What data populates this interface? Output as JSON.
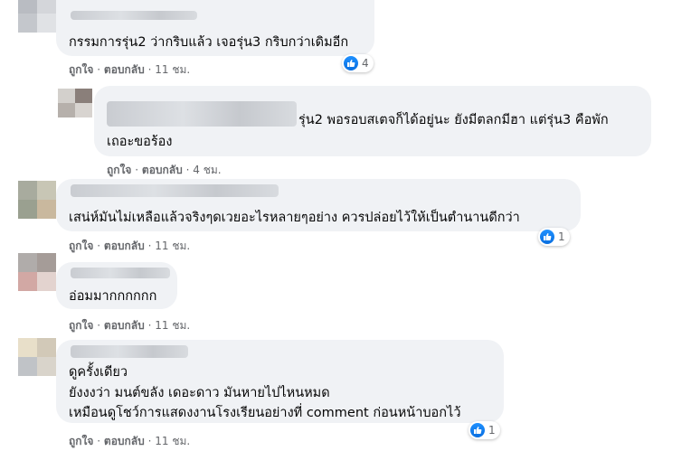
{
  "actions": {
    "like": "ถูกใจ",
    "reply": "ตอบกลับ",
    "sep": "·"
  },
  "colors": {
    "like_blue": "#1877f2",
    "bubble_bg": "#f0f2f5",
    "meta_gray": "#65676b"
  },
  "comments": [
    {
      "text_lines": [
        "กรรมการรุ่น2 ว่ากริบแล้ว เจอรุ่น3 กริบกว่าเดิมอีก"
      ],
      "time": "11 ชม.",
      "reaction": {
        "icon": "like-icon",
        "count": "4"
      }
    },
    {
      "text_lines": [
        "รุ่น2 พอรอบสเตจก็ได้อยู่นะ ยังมีตลกมีฮา แต่รุ่น3 คือพัก",
        "เถอะขอร้อง"
      ],
      "time": "4 ชม.",
      "reaction": null
    },
    {
      "text_lines": [
        "เสน่ห์มันไม่เหลือแล้วจริงๆดเวยอะไรหลายๆอย่าง ควรปล่อยไว้ให้เป็นตำนานดีกว่า"
      ],
      "time": "11 ชม.",
      "reaction": {
        "icon": "like-icon",
        "count": "1"
      }
    },
    {
      "text_lines": [
        "อ่อมมากกกกกก"
      ],
      "time": "11 ชม.",
      "reaction": null
    },
    {
      "text_lines": [
        "ดูครั้งเดียว",
        "ยังงงว่า มนต์ขลัง เดอะดาว มันหายไปไหนหมด",
        "เหมือนดูโชว์การแสดงงานโรงเรียนอย่างที่ comment ก่อนหน้าบอกไว้"
      ],
      "time": "11 ชม.",
      "reaction": {
        "icon": "like-icon",
        "count": "1"
      }
    }
  ]
}
